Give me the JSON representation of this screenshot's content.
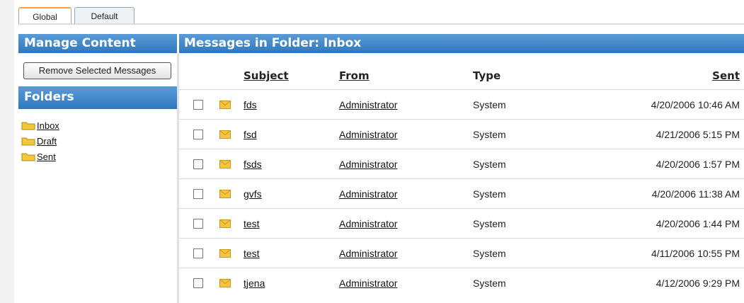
{
  "tabs": [
    {
      "label": "Global",
      "active": true
    },
    {
      "label": "Default",
      "active": false
    }
  ],
  "sidebar": {
    "title": "Manage Content",
    "remove_button": "Remove Selected Messages",
    "folders_title": "Folders",
    "folders": [
      {
        "label": "Inbox",
        "icon": "folder-icon"
      },
      {
        "label": "Draft",
        "icon": "folder-icon"
      },
      {
        "label": "Sent",
        "icon": "folder-icon"
      }
    ]
  },
  "main": {
    "title": "Messages in Folder: Inbox",
    "columns": {
      "subject": "Subject",
      "from": "From",
      "type": "Type",
      "sent": "Sent"
    },
    "rows": [
      {
        "subject": "fds",
        "from": "Administrator",
        "type": "System",
        "sent": "4/20/2006 10:46 AM"
      },
      {
        "subject": "fsd",
        "from": "Administrator",
        "type": "System",
        "sent": "4/21/2006 5:15 PM"
      },
      {
        "subject": "fsds",
        "from": "Administrator",
        "type": "System",
        "sent": "4/20/2006 1:57 PM"
      },
      {
        "subject": "gvfs",
        "from": "Administrator",
        "type": "System",
        "sent": "4/20/2006 11:38 AM"
      },
      {
        "subject": "test",
        "from": "Administrator",
        "type": "System",
        "sent": "4/20/2006 1:44 PM"
      },
      {
        "subject": "test",
        "from": "Administrator",
        "type": "System",
        "sent": "4/11/2006 10:55 PM"
      },
      {
        "subject": "tjena",
        "from": "Administrator",
        "type": "System",
        "sent": "4/12/2006 9:29 PM"
      }
    ]
  },
  "colors": {
    "header_top": "#5a9bd6",
    "header_bottom": "#2f78be",
    "tab_accent": "#f0a33a",
    "folder": "#f2c83a",
    "envelope": "#f4c542"
  }
}
